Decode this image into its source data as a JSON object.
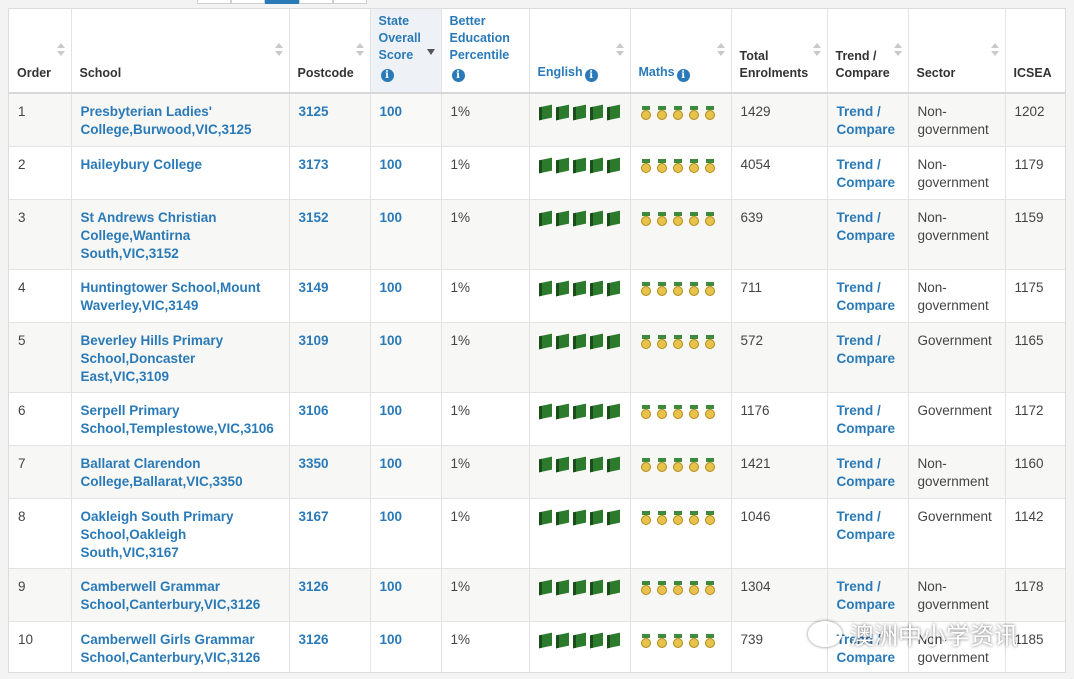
{
  "headers": {
    "order": "Order",
    "school": "School",
    "postcode": "Postcode",
    "state_score": "State Overall Score",
    "better_edu": "Better Education Percentile",
    "english": "English",
    "maths": "Maths",
    "total": "Total Enrolments",
    "trend": "Trend / Compare",
    "sector": "Sector",
    "icsea": "ICSEA"
  },
  "rows": [
    {
      "order": "1",
      "school": "Presbyterian Ladies' College,Burwood,VIC,3125",
      "postcode": "3125",
      "score": "100",
      "percentile": "1%",
      "english_rating": 5,
      "maths_rating": 5,
      "enrol": "1429",
      "trend": "Trend / Compare",
      "sector": "Non-government",
      "icsea": "1202"
    },
    {
      "order": "2",
      "school": "Haileybury College",
      "postcode": "3173",
      "score": "100",
      "percentile": "1%",
      "english_rating": 5,
      "maths_rating": 5,
      "enrol": "4054",
      "trend": "Trend / Compare",
      "sector": "Non-government",
      "icsea": "1179"
    },
    {
      "order": "3",
      "school": "St Andrews Christian College,Wantirna South,VIC,3152",
      "postcode": "3152",
      "score": "100",
      "percentile": "1%",
      "english_rating": 5,
      "maths_rating": 5,
      "enrol": "639",
      "trend": "Trend / Compare",
      "sector": "Non-government",
      "icsea": "1159"
    },
    {
      "order": "4",
      "school": "Huntingtower School,Mount Waverley,VIC,3149",
      "postcode": "3149",
      "score": "100",
      "percentile": "1%",
      "english_rating": 5,
      "maths_rating": 5,
      "enrol": "711",
      "trend": "Trend / Compare",
      "sector": "Non-government",
      "icsea": "1175"
    },
    {
      "order": "5",
      "school": "Beverley Hills Primary School,Doncaster East,VIC,3109",
      "postcode": "3109",
      "score": "100",
      "percentile": "1%",
      "english_rating": 5,
      "maths_rating": 5,
      "enrol": "572",
      "trend": "Trend / Compare",
      "sector": "Government",
      "icsea": "1165"
    },
    {
      "order": "6",
      "school": "Serpell Primary School,Templestowe,VIC,3106",
      "postcode": "3106",
      "score": "100",
      "percentile": "1%",
      "english_rating": 5,
      "maths_rating": 5,
      "enrol": "1176",
      "trend": "Trend / Compare",
      "sector": "Government",
      "icsea": "1172"
    },
    {
      "order": "7",
      "school": "Ballarat Clarendon College,Ballarat,VIC,3350",
      "postcode": "3350",
      "score": "100",
      "percentile": "1%",
      "english_rating": 5,
      "maths_rating": 5,
      "enrol": "1421",
      "trend": "Trend / Compare",
      "sector": "Non-government",
      "icsea": "1160"
    },
    {
      "order": "8",
      "school": "Oakleigh South Primary School,Oakleigh South,VIC,3167",
      "postcode": "3167",
      "score": "100",
      "percentile": "1%",
      "english_rating": 5,
      "maths_rating": 5,
      "enrol": "1046",
      "trend": "Trend / Compare",
      "sector": "Government",
      "icsea": "1142"
    },
    {
      "order": "9",
      "school": "Camberwell Grammar School,Canterbury,VIC,3126",
      "postcode": "3126",
      "score": "100",
      "percentile": "1%",
      "english_rating": 5,
      "maths_rating": 5,
      "enrol": "1304",
      "trend": "Trend / Compare",
      "sector": "Non-government",
      "icsea": "1178"
    },
    {
      "order": "10",
      "school": "Camberwell Girls Grammar School,Canterbury,VIC,3126",
      "postcode": "3126",
      "score": "100",
      "percentile": "1%",
      "english_rating": 5,
      "maths_rating": 5,
      "enrol": "739",
      "trend": "Trend / Compare",
      "sector": "Non-government",
      "icsea": "1185"
    }
  ],
  "row_heights": [
    53,
    53,
    70,
    53,
    70,
    53,
    53,
    70,
    53,
    53
  ],
  "icons": {
    "info": "info-icon",
    "english": "book-icon",
    "maths": "medal-icon",
    "sort": "sort-icon"
  },
  "colors": {
    "link": "#2a7ab8",
    "book": "#2c7a2c",
    "medal": "#e8c24a"
  },
  "watermark": "澳洲中小学资讯"
}
